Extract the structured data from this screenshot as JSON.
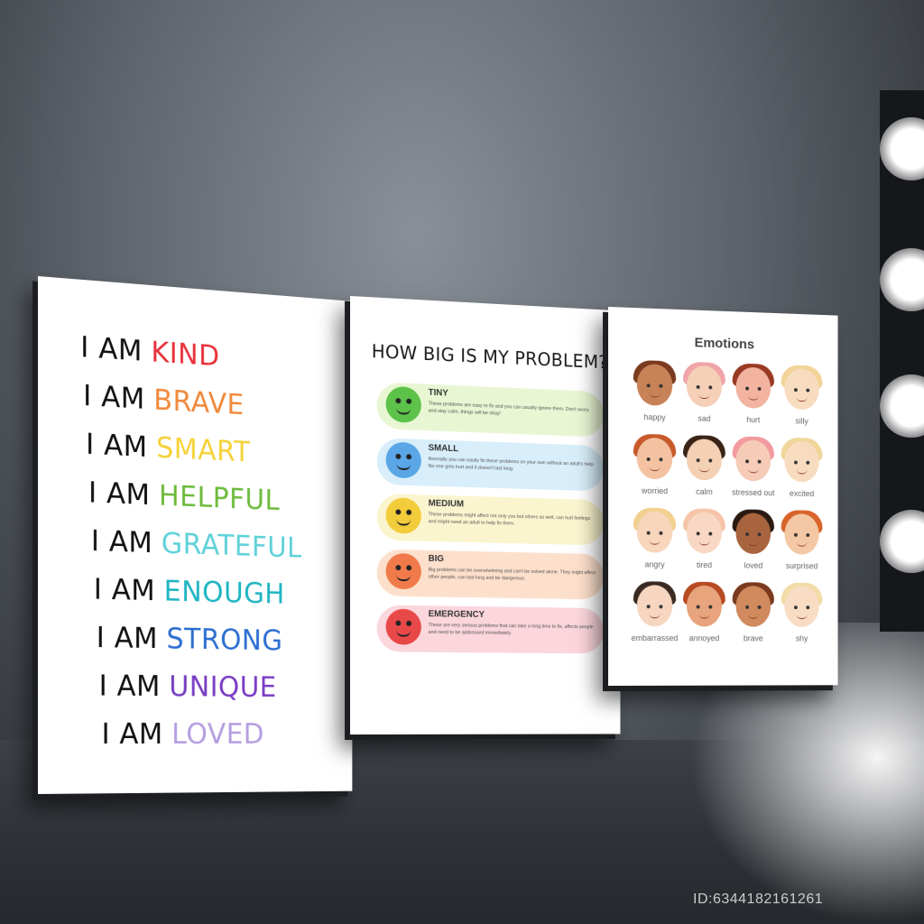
{
  "affirmations": {
    "prefix": "I AM",
    "items": [
      {
        "word": "KIND",
        "color": "#e8323c"
      },
      {
        "word": "BRAVE",
        "color": "#f08a3c"
      },
      {
        "word": "SMART",
        "color": "#f5d23a"
      },
      {
        "word": "HELPFUL",
        "color": "#6dbb3d"
      },
      {
        "word": "GRATEFUL",
        "color": "#5fd1d8"
      },
      {
        "word": "ENOUGH",
        "color": "#1fb5c2"
      },
      {
        "word": "STRONG",
        "color": "#2d6fd1"
      },
      {
        "word": "UNIQUE",
        "color": "#7a3ec4"
      },
      {
        "word": "LOVED",
        "color": "#b59ee0"
      }
    ]
  },
  "problem": {
    "title": "HOW BIG IS MY PROBLEM?",
    "levels": [
      {
        "label": "TINY",
        "text": "These problems are easy to fix and you can usually ignore them. Don't worry and stay calm, things will be okay!",
        "band": "#e9f6d3",
        "face": "#5cc24a"
      },
      {
        "label": "SMALL",
        "text": "Normally you can easily fix these problems on your own without an adult's help. No one gets hurt and it doesn't last long.",
        "band": "#d8eefa",
        "face": "#5aa6e6"
      },
      {
        "label": "MEDIUM",
        "text": "These problems might affect not only you but others as well, can hurt feelings and might need an adult to help fix them.",
        "band": "#fbf5cf",
        "face": "#f2cc3a"
      },
      {
        "label": "BIG",
        "text": "Big problems can be overwhelming and can't be solved alone. They might affect other people, can last long and be dangerous.",
        "band": "#fde0cc",
        "face": "#f07a4a"
      },
      {
        "label": "EMERGENCY",
        "text": "These are very serious problems that can take a long time to fix, affects people and need to be addressed immediately.",
        "band": "#fbd6dc",
        "face": "#e84848"
      }
    ]
  },
  "emotions": {
    "title": "Emotions",
    "faces": [
      {
        "label": "happy",
        "hair": "#7a3a1e",
        "skin": "#c88258"
      },
      {
        "label": "sad",
        "hair": "#f0a4a8",
        "skin": "#f6cfb8"
      },
      {
        "label": "hurt",
        "hair": "#9a3a22",
        "skin": "#f2b4a0"
      },
      {
        "label": "silly",
        "hair": "#f2d49a",
        "skin": "#f8dcc0"
      },
      {
        "label": "worried",
        "hair": "#c85a2a",
        "skin": "#f4c2a0"
      },
      {
        "label": "calm",
        "hair": "#3a2418",
        "skin": "#f4d0b4"
      },
      {
        "label": "stressed out",
        "hair": "#f29aa0",
        "skin": "#f6cbb8"
      },
      {
        "label": "excited",
        "hair": "#f0d69a",
        "skin": "#f8dcc0"
      },
      {
        "label": "angry",
        "hair": "#f2d090",
        "skin": "#f8d6bc"
      },
      {
        "label": "tired",
        "hair": "#f6c4a8",
        "skin": "#f8d8c4"
      },
      {
        "label": "loved",
        "hair": "#2a1a12",
        "skin": "#a8643e"
      },
      {
        "label": "surprised",
        "hair": "#d8642a",
        "skin": "#f4c8a4"
      },
      {
        "label": "embarrassed",
        "hair": "#3a2a22",
        "skin": "#f6d6c0"
      },
      {
        "label": "annoyed",
        "hair": "#b84a22",
        "skin": "#e8a47c"
      },
      {
        "label": "brave",
        "hair": "#7a3a1e",
        "skin": "#d08a5e"
      },
      {
        "label": "shy",
        "hair": "#f2dca8",
        "skin": "#f8dcc4"
      }
    ]
  },
  "watermark": "ID:6344182161261"
}
